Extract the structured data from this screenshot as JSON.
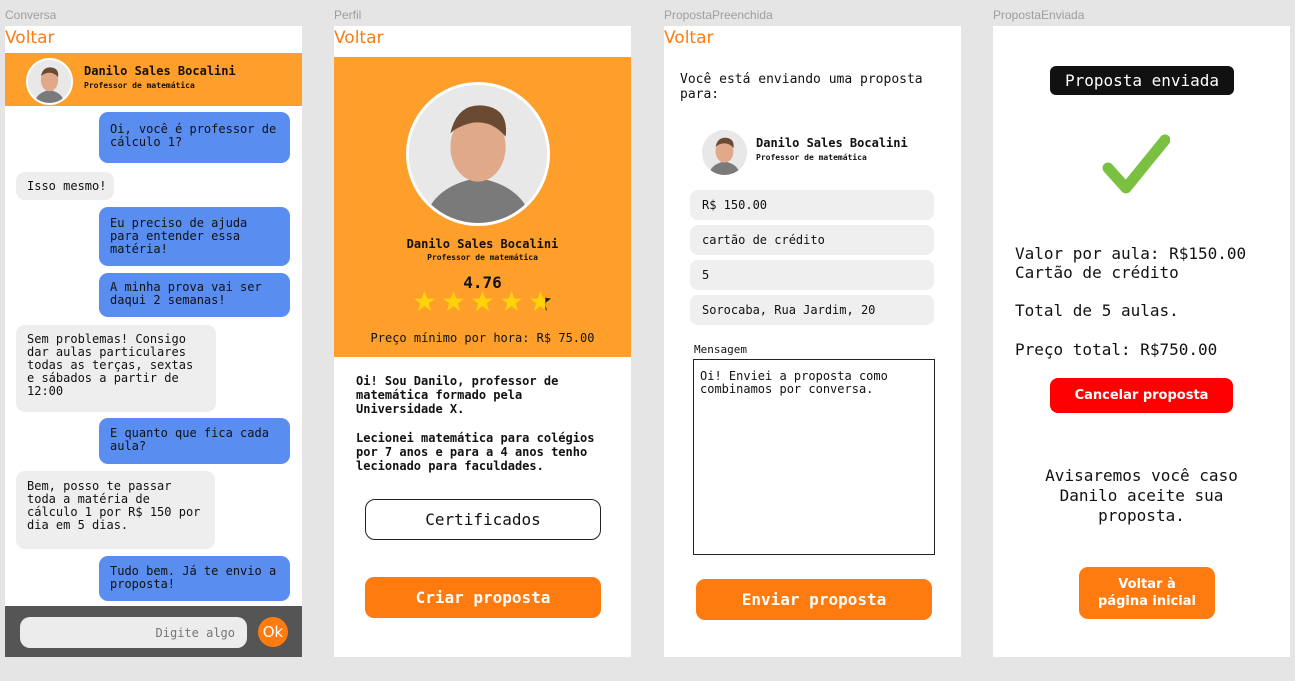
{
  "frames": {
    "conversa": "Conversa",
    "perfil": "Perfil",
    "preenchida": "PropostaPreenchida",
    "enviada": "PropostaEnviada"
  },
  "back_label": "Voltar",
  "teacher": {
    "name": "Danilo Sales Bocalini",
    "role": "Professor de matemática"
  },
  "chat": {
    "messages": [
      {
        "from": "me",
        "text": "Oi, você é professor de\ncálculo 1?"
      },
      {
        "from": "them",
        "text": "Isso mesmo!"
      },
      {
        "from": "me",
        "text": "Eu preciso de ajuda\npara entender essa\nmatéria!"
      },
      {
        "from": "me",
        "text": "A minha prova vai ser\ndaqui 2 semanas!"
      },
      {
        "from": "them",
        "text": "Sem problemas! Consigo\ndar aulas particulares\ntodas as terças, sextas\ne sábados a partir de\n12:00"
      },
      {
        "from": "me",
        "text": "E quanto que fica cada\naula?"
      },
      {
        "from": "them",
        "text": "Bem, posso te passar\ntoda a matéria de\ncálculo 1 por R$ 150 por\ndia em 5 dias."
      },
      {
        "from": "me",
        "text": "Tudo bem. Já te envio a\nproposta!"
      }
    ],
    "input_placeholder": "Digite algo",
    "send_label": "Ok"
  },
  "profile": {
    "rating": "4.76",
    "rating_value": 4.76,
    "min_price": "Preço mínimo por hora: R$ 75.00",
    "bio1": "Oi! Sou Danilo, professor de\nmatemática formado pela\nUniversidade X.",
    "bio2": "Lecionei matemática para colégios\npor 7 anos e para a 4 anos tenho\nlecionado para faculdades.",
    "certificates_label": "Certificados",
    "create_label": "Criar proposta"
  },
  "proposal_form": {
    "intro": "Você está enviando uma proposta\npara:",
    "price": "R$ 150.00",
    "payment": "cartão de crédito",
    "lessons": "5",
    "address": "Sorocaba, Rua Jardim, 20",
    "message_label": "Mensagem",
    "message": "Oi! Enviei a proposta como\ncombinamos por conversa.",
    "send_label": "Enviar proposta"
  },
  "sent": {
    "tag": "Proposta enviada",
    "value_line": "Valor por aula: R$150.00",
    "payment_line": "Cartão de crédito",
    "total_lessons": "Total de 5 aulas.",
    "total_price": "Preço total: R$750.00",
    "cancel_label": "Cancelar proposta",
    "notice": "Avisaremos você caso\nDanilo aceite sua\nproposta.",
    "home_label": "Voltar à\npágina inicial"
  },
  "colors": {
    "orange": "#ff9f2b",
    "orange_button": "#ff7a0f",
    "blue_bubble": "#5a8df0",
    "gray_bubble": "#eeeeee",
    "red": "#ff0000",
    "check_green": "#7ac142",
    "star": "#ffd20a"
  },
  "icons": [
    "teacher-avatar",
    "star-icon",
    "check-icon"
  ]
}
